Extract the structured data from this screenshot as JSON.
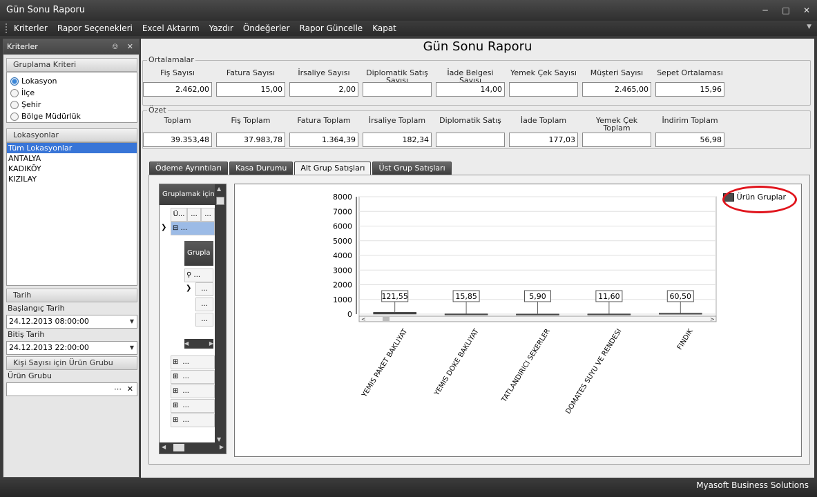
{
  "window": {
    "title": "Gün Sonu Raporu"
  },
  "menu": [
    "Kriterler",
    "Rapor Seçenekleri",
    "Excel Aktarım",
    "Yazdır",
    "Öndeğerler",
    "Rapor Güncelle",
    "Kapat"
  ],
  "left": {
    "title": "Kriterler",
    "grouping": {
      "title": "Gruplama Kriteri",
      "options": [
        "Lokasyon",
        "İlçe",
        "Şehir",
        "Bölge Müdürlük"
      ],
      "selected": "Lokasyon"
    },
    "locations": {
      "title": "Lokasyonlar",
      "items": [
        "Tüm Lokasyonlar",
        "ANTALYA",
        "KADIKÖY",
        "KIZILAY"
      ],
      "selected": "Tüm Lokasyonlar"
    },
    "date": {
      "title": "Tarih",
      "start_label": "Başlangıç Tarih",
      "start_value": "24.12.2013 08:00:00",
      "end_label": "Bitiş Tarih",
      "end_value": "24.12.2013 22:00:00"
    },
    "product": {
      "title": "Kişi Sayısı için Ürün Grubu",
      "label": "Ürün Grubu",
      "value": ""
    }
  },
  "report": {
    "title": "Gün Sonu Raporu",
    "averages": {
      "legend": "Ortalamalar",
      "fields": [
        {
          "label": "Fiş Sayısı",
          "value": "2.462,00"
        },
        {
          "label": "Fatura Sayısı",
          "value": "15,00"
        },
        {
          "label": "İrsaliye Sayısı",
          "value": "2,00"
        },
        {
          "label": "Diplomatik Satış Sayısı",
          "value": ""
        },
        {
          "label": "İade Belgesi Sayısı",
          "value": "14,00"
        },
        {
          "label": "Yemek Çek Sayısı",
          "value": ""
        },
        {
          "label": "Müşteri Sayısı",
          "value": "2.465,00"
        },
        {
          "label": "Sepet Ortalaması",
          "value": "15,96"
        }
      ]
    },
    "summary": {
      "legend": "Özet",
      "fields": [
        {
          "label": "Toplam",
          "value": "39.353,48"
        },
        {
          "label": "Fiş Toplam",
          "value": "37.983,78"
        },
        {
          "label": "Fatura Toplam",
          "value": "1.364,39"
        },
        {
          "label": "İrsaliye Toplam",
          "value": "182,34"
        },
        {
          "label": "Diplomatik Satış",
          "value": ""
        },
        {
          "label": "İade Toplam",
          "value": "177,03"
        },
        {
          "label": "Yemek Çek Toplam",
          "value": ""
        },
        {
          "label": "İndirim Toplam",
          "value": "56,98"
        }
      ]
    },
    "tabs": [
      "Ödeme Ayrıntıları",
      "Kasa Durumu",
      "Alt Grup Satışları",
      "Üst Grup Satışları"
    ],
    "active_tab": "Alt Grup Satışları",
    "grid": {
      "header": "Gruplamak için",
      "sub_header": "Grupla",
      "col1": "Ü...",
      "ellipsis": "..."
    }
  },
  "chart_data": {
    "type": "bar",
    "categories": [
      "YEMIS PAKET BAKLIYAT",
      "YEMIS DOKE BAKLIYAT",
      "TATLANDIRICI SEKERLER",
      "DOMATES SUYU VE RENDESI",
      "FINDIK"
    ],
    "series": [
      {
        "name": "Ürün Gruplar",
        "values": [
          121.55,
          15.85,
          5.9,
          11.6,
          60.5
        ]
      }
    ],
    "labels": [
      "121,55",
      "15,85",
      "5,90",
      "11,60",
      "60,50"
    ],
    "ylim": [
      0,
      8000
    ],
    "yticks": [
      0,
      1000,
      2000,
      3000,
      4000,
      5000,
      6000,
      7000,
      8000
    ],
    "legend": "top-right",
    "grid": true,
    "bar_color": "#4b4b4b"
  },
  "status": {
    "text": "Myasoft Business Solutions"
  }
}
